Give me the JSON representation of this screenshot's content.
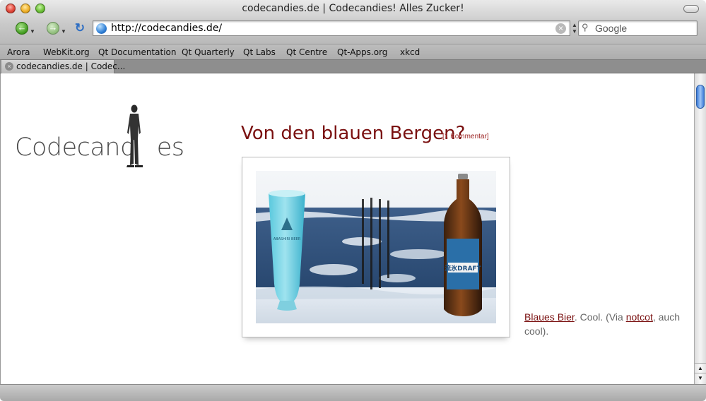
{
  "window": {
    "title": "codecandies.de | Codecandies! Alles Zucker!"
  },
  "toolbar": {
    "url": "http://codecandies.de/",
    "search_engine": "Google"
  },
  "bookmarks": [
    "Arora",
    "WebKit.org",
    "Qt Documentation",
    "Qt Quarterly",
    "Qt Labs",
    "Qt Centre",
    "Qt-Apps.org",
    "xkcd"
  ],
  "tabs": [
    {
      "label": "codecandies.de | Codec..."
    }
  ],
  "page": {
    "logo_left": "Codecand",
    "logo_right": "es",
    "post_title": "Von den blauen Bergen?",
    "post_comments": "[1 Kommentar]",
    "caption": {
      "link1": "Blaues Bier",
      "text1": ". Cool. (Via ",
      "link2": "notcot",
      "text2": ", auch cool)."
    },
    "bottle_label": "流氷DRAFT",
    "glass_label": "ABASHIRI BEER"
  },
  "icons": {
    "back": "back-arrow-icon",
    "forward": "forward-arrow-icon",
    "reload": "reload-icon",
    "site": "globe-icon",
    "search": "magnifier-icon"
  },
  "colors": {
    "accent": "#7a1010",
    "link": "#7a1010"
  }
}
